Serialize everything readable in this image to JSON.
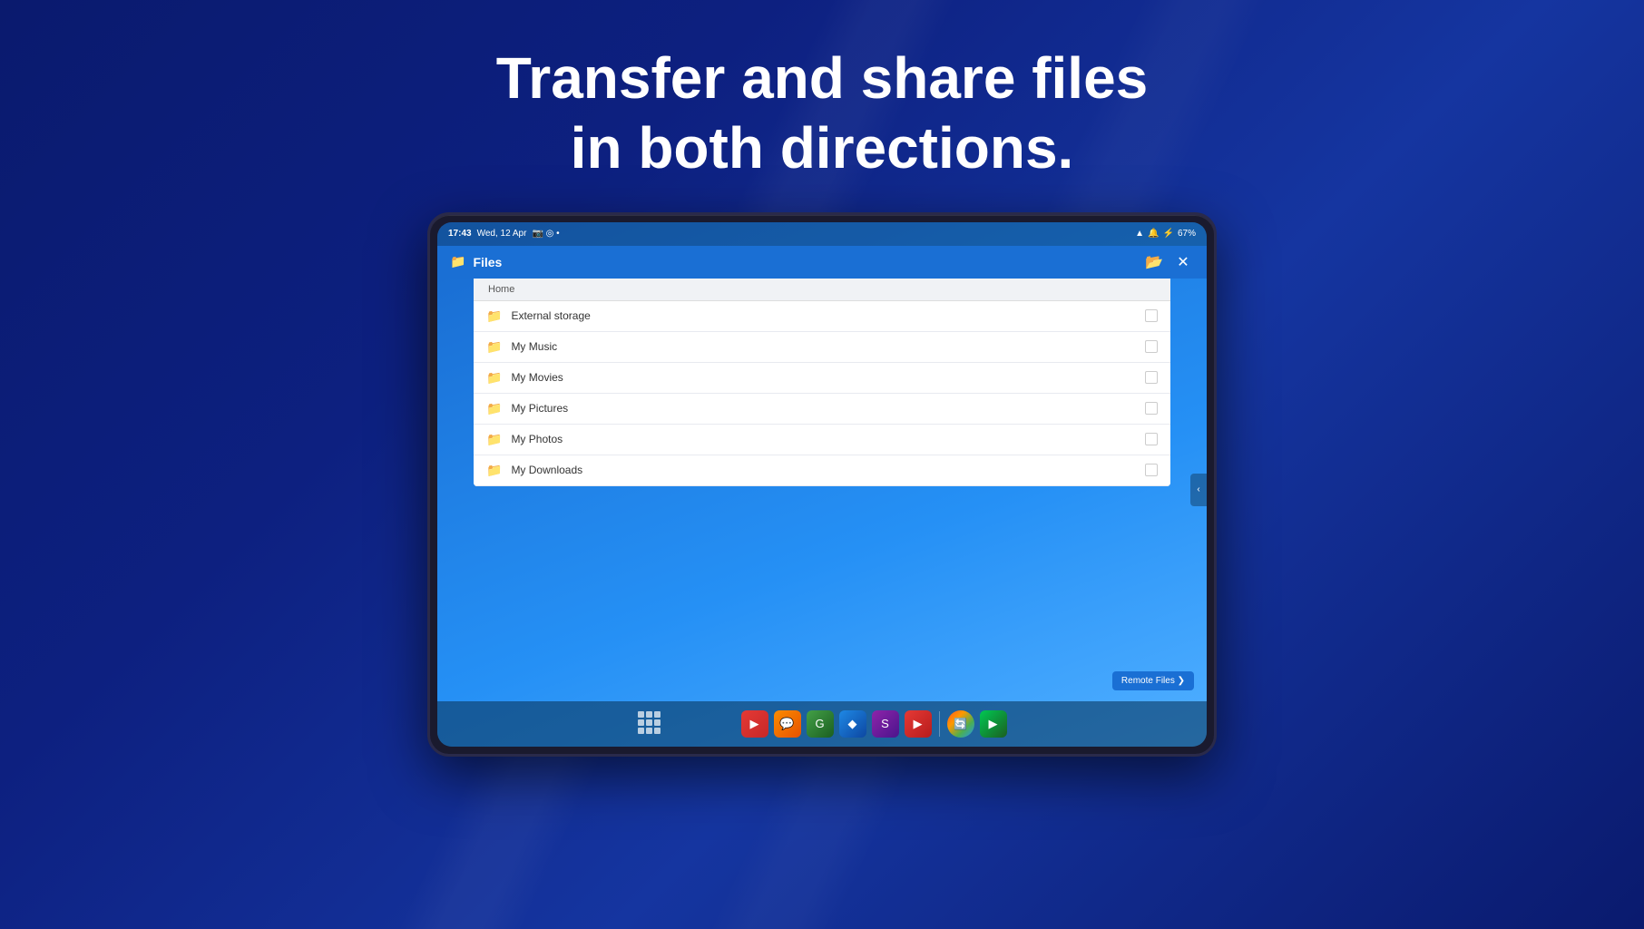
{
  "headline": {
    "line1": "Transfer and share files",
    "line2": "in both directions."
  },
  "tablet": {
    "statusBar": {
      "time": "17:43",
      "date": "Wed, 12 Apr",
      "battery": "67%"
    },
    "titleBar": {
      "title": "Files",
      "closeLabel": "✕"
    },
    "fileManager": {
      "breadcrumb": "Home",
      "items": [
        {
          "name": "External storage"
        },
        {
          "name": "My Music"
        },
        {
          "name": "My Movies"
        },
        {
          "name": "My Pictures"
        },
        {
          "name": "My Photos"
        },
        {
          "name": "My Downloads"
        }
      ]
    },
    "remoteFilesButton": "Remote Files ❯"
  }
}
